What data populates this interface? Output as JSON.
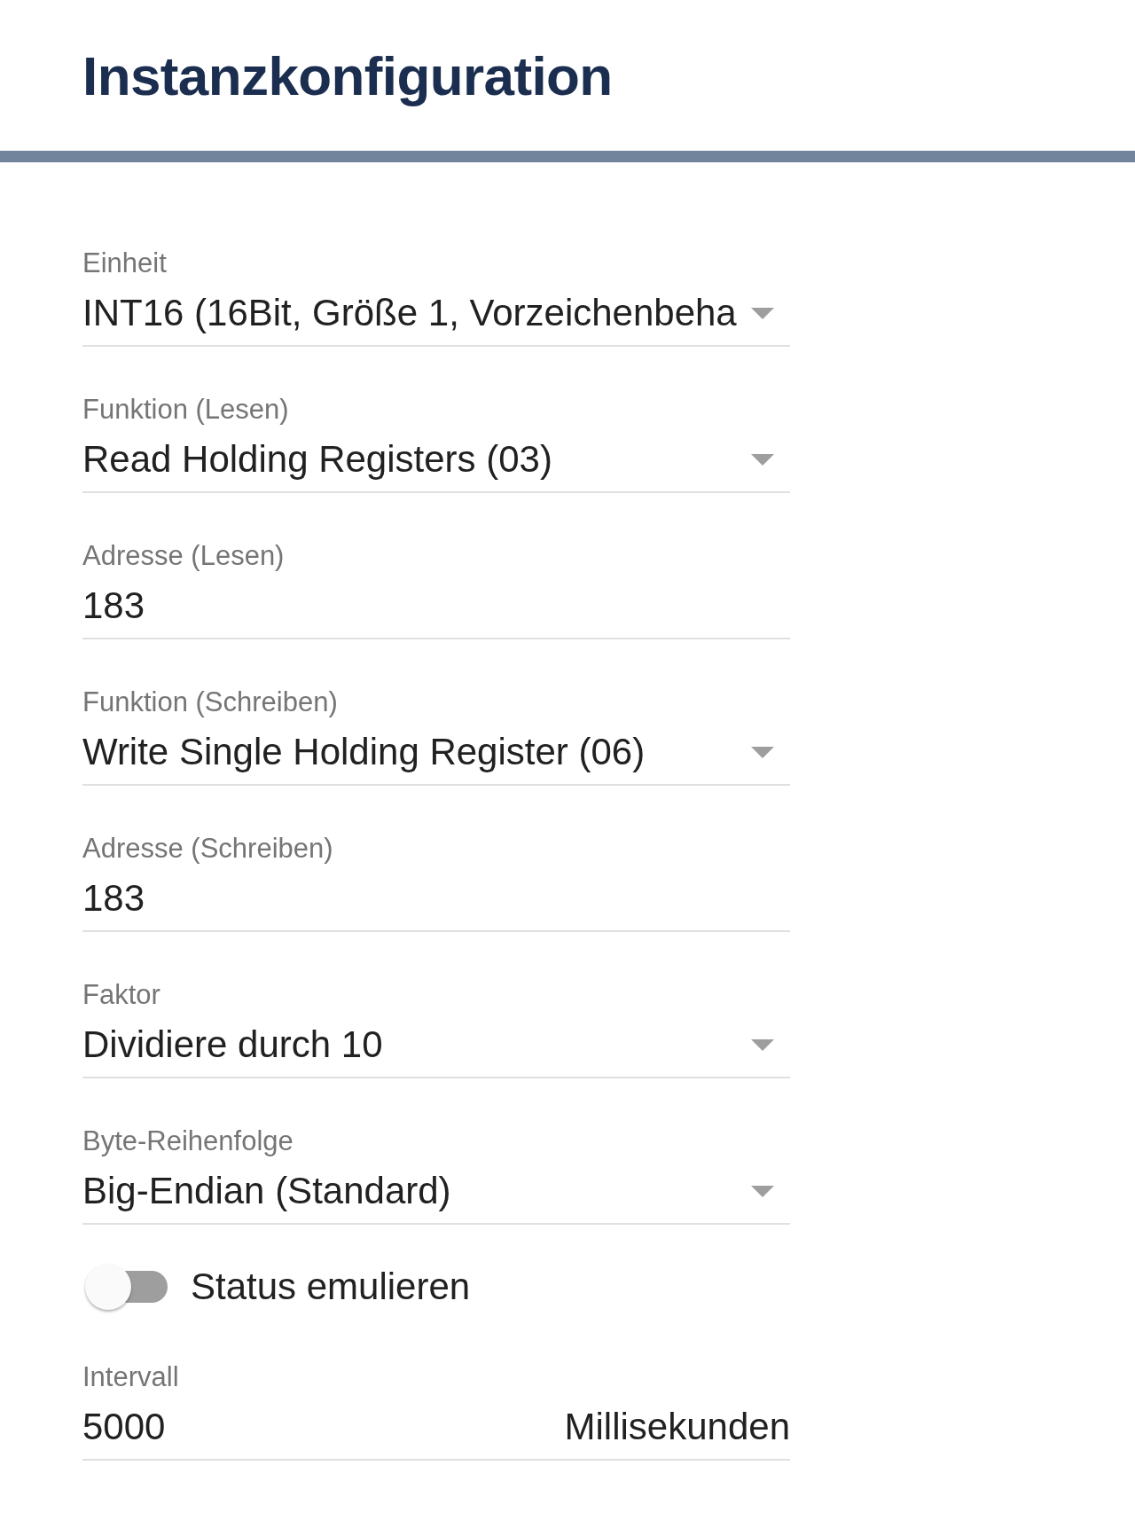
{
  "title": "Instanzkonfiguration",
  "fields": [
    {
      "kind": "select",
      "label": "Einheit",
      "value": "INT16 (16Bit, Größe 1, Vorzeichenbeha"
    },
    {
      "kind": "select",
      "label": "Funktion (Lesen)",
      "value": "Read Holding Registers (03)"
    },
    {
      "kind": "input",
      "label": "Adresse (Lesen)",
      "value": "183"
    },
    {
      "kind": "select",
      "label": "Funktion (Schreiben)",
      "value": "Write Single Holding Register (06)"
    },
    {
      "kind": "input",
      "label": "Adresse (Schreiben)",
      "value": "183"
    },
    {
      "kind": "select",
      "label": "Faktor",
      "value": "Dividiere durch 10"
    },
    {
      "kind": "select",
      "label": "Byte-Reihenfolge",
      "value": "Big-Endian (Standard)"
    },
    {
      "kind": "switch",
      "label": "Status emulieren",
      "on": false
    },
    {
      "kind": "input",
      "label": "Intervall",
      "value": "5000",
      "suffix": "Millisekunden"
    }
  ]
}
